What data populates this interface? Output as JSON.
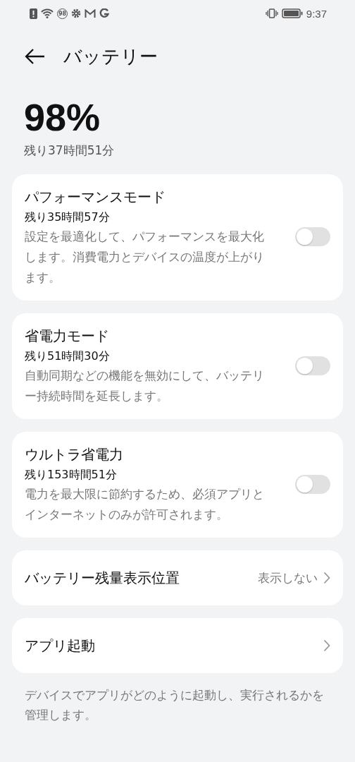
{
  "status_bar": {
    "notification_badge": "98",
    "time": "9:37"
  },
  "header": {
    "title": "バッテリー"
  },
  "battery": {
    "percent": "98%",
    "remaining": "残り37時間51分"
  },
  "modes": [
    {
      "title": "パフォーマンスモード",
      "remaining": "残り35時間57分",
      "description": "設定を最適化して、パフォーマンスを最大化します。消費電力とデバイスの温度が上がります。",
      "on": false
    },
    {
      "title": "省電力モード",
      "remaining": "残り51時間30分",
      "description": "自動同期などの機能を無効にして、バッテリー持続時間を延長します。",
      "on": false
    },
    {
      "title": "ウルトラ省電力",
      "remaining": "残り153時間51分",
      "description": "電力を最大限に節約するため、必須アプリとインターネットのみが許可されます。",
      "on": false
    }
  ],
  "settings": [
    {
      "label": "バッテリー残量表示位置",
      "value": "表示しない"
    },
    {
      "label": "アプリ起動"
    }
  ],
  "footer": "デバイスでアプリがどのように起動し、実行されるかを管理します。"
}
